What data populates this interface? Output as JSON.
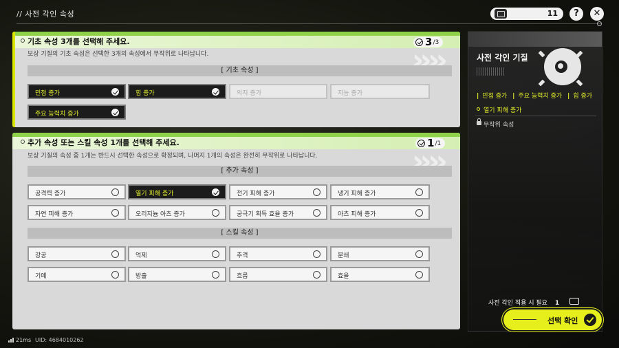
{
  "header": {
    "title": "// 사전 각인 속성",
    "currency_count": "11"
  },
  "basic_card": {
    "title": "기초 속성 3개를 선택해 주세요.",
    "description": "보상 기질의 기초 속성은 선택한 3개의 속성에서 무작위로 나타납니다.",
    "selected_count": "3",
    "max_count": "3",
    "section_label": "[ 기초 속성 ]",
    "options": [
      {
        "label": "민첩 증가",
        "state": "selected"
      },
      {
        "label": "힘 증가",
        "state": "selected"
      },
      {
        "label": "의지 증가",
        "state": "disabled"
      },
      {
        "label": "지능 증가",
        "state": "disabled"
      },
      {
        "label": "주요 능력치 증가",
        "state": "selected"
      }
    ]
  },
  "extra_card": {
    "title": "추가 속성 또는 스킬 속성 1개를 선택해 주세요.",
    "description": "보상 기질의 속성 중 1개는 반드시 선택한 속성으로 확정되며, 나머지 1개의 속성은 완전히 무작위로 나타납니다.",
    "selected_count": "1",
    "max_count": "1",
    "extra_section_label": "[ 추가 속성 ]",
    "extra_options": [
      {
        "label": "공격력 증가",
        "state": "normal"
      },
      {
        "label": "열기 피해 증가",
        "state": "selected"
      },
      {
        "label": "전기 피해 증가",
        "state": "normal"
      },
      {
        "label": "냉기 피해 증가",
        "state": "normal"
      },
      {
        "label": "자연 피해 증가",
        "state": "normal"
      },
      {
        "label": "오리지늄 아츠 증가",
        "state": "normal"
      },
      {
        "label": "궁극기 획득 효율 증가",
        "state": "normal"
      },
      {
        "label": "아츠 피해 증가",
        "state": "normal"
      }
    ],
    "skill_section_label": "[ 스킬 속성 ]",
    "skill_options": [
      {
        "label": "강공",
        "state": "normal"
      },
      {
        "label": "억제",
        "state": "normal"
      },
      {
        "label": "추격",
        "state": "normal"
      },
      {
        "label": "분쇄",
        "state": "normal"
      },
      {
        "label": "기예",
        "state": "normal"
      },
      {
        "label": "방출",
        "state": "normal"
      },
      {
        "label": "흐름",
        "state": "normal"
      },
      {
        "label": "효율",
        "state": "normal"
      }
    ]
  },
  "side_panel": {
    "title": "사전 각인 기질",
    "stats": [
      "민첩 증가",
      "주요 능력치 증가",
      "힘 증가"
    ],
    "extra_stat": "열기 피해 증가",
    "random_label": "무작위 속성",
    "requirement_text": "사전 각인 적용 시 필요",
    "requirement_count": "1",
    "confirm_label": "선택 확인"
  },
  "footer": {
    "ping": "21ms",
    "uid": "UID: 4684010262"
  },
  "colors": {
    "accent_yellow": "#e3ee2a",
    "card_green": "#8fd24a",
    "confirm_yellow": "#e6ee1c"
  }
}
